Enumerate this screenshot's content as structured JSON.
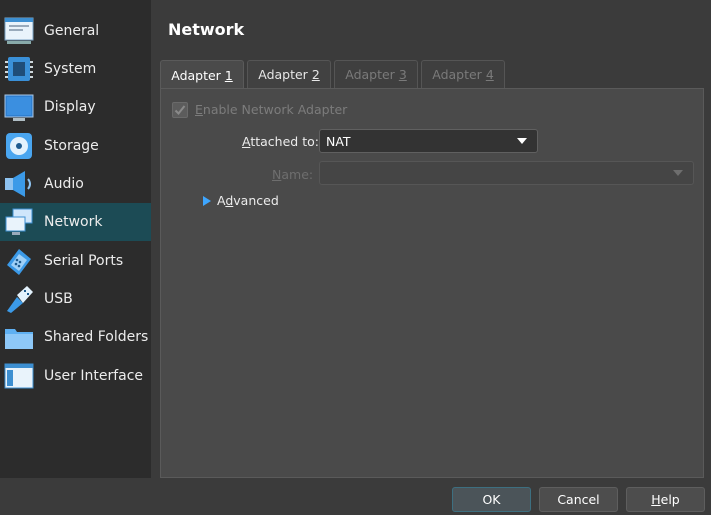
{
  "sidebar": {
    "items": [
      {
        "label": "General",
        "icon": "general-icon"
      },
      {
        "label": "System",
        "icon": "system-chip-icon"
      },
      {
        "label": "Display",
        "icon": "display-monitor-icon"
      },
      {
        "label": "Storage",
        "icon": "storage-disc-icon"
      },
      {
        "label": "Audio",
        "icon": "audio-speaker-icon"
      },
      {
        "label": "Network",
        "icon": "network-icon",
        "selected": true
      },
      {
        "label": "Serial Ports",
        "icon": "serial-port-icon"
      },
      {
        "label": "USB",
        "icon": "usb-icon"
      },
      {
        "label": "Shared Folders",
        "icon": "shared-folder-icon"
      },
      {
        "label": "User Interface",
        "icon": "user-interface-icon"
      }
    ]
  },
  "page": {
    "title": "Network"
  },
  "tabs": [
    {
      "prefix": "Adapter ",
      "key": "1",
      "active": true,
      "enabled": true
    },
    {
      "prefix": "Adapter ",
      "key": "2",
      "active": false,
      "enabled": true
    },
    {
      "prefix": "Adapter ",
      "key": "3",
      "active": false,
      "enabled": false
    },
    {
      "prefix": "Adapter ",
      "key": "4",
      "active": false,
      "enabled": false
    }
  ],
  "adapter": {
    "enable_label_key": "E",
    "enable_label_rest": "nable Network Adapter",
    "enable_checked": true,
    "attached_label_key": "A",
    "attached_label_rest": "ttached to:",
    "attached_value": "NAT",
    "name_label_key": "N",
    "name_label_rest": "ame:",
    "name_value": "",
    "advanced_label_pre": "A",
    "advanced_label_key": "d",
    "advanced_label_rest": "vanced"
  },
  "buttons": {
    "ok": "OK",
    "cancel": "Cancel",
    "help_key": "H",
    "help_rest": "elp"
  },
  "colors": {
    "selected_bg": "#1c4b55",
    "accent": "#3ea6ff"
  }
}
